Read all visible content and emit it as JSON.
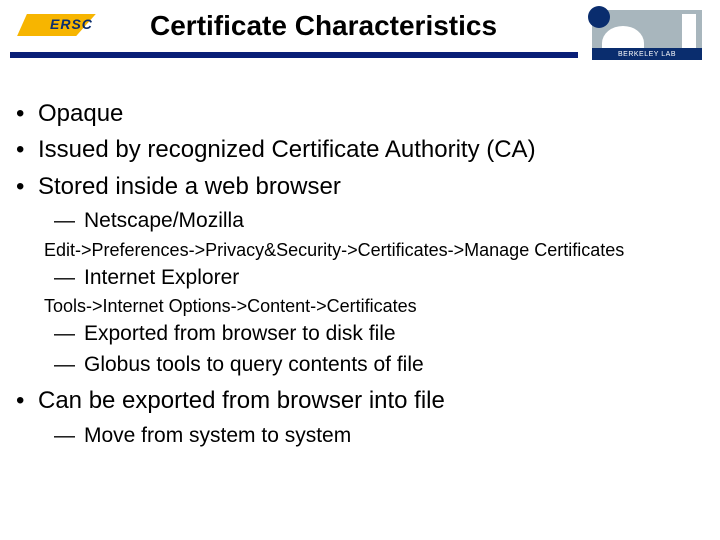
{
  "header": {
    "logo_left_text": "ERSC",
    "title": "Certificate Characteristics",
    "logo_right_caption": "BERKELEY LAB"
  },
  "bullets": {
    "b1": "Opaque",
    "b2": "Issued by recognized Certificate Authority (CA)",
    "b3": "Stored inside a web browser",
    "b3a": "Netscape/Mozilla",
    "b3a_note": "Edit->Preferences->Privacy&Security->Certificates->Manage Certificates",
    "b3b": "Internet Explorer",
    "b3b_note": "Tools->Internet Options->Content->Certificates",
    "b3c": "Exported from browser to disk file",
    "b3d": "Globus tools to query contents of file",
    "b4": "Can be exported from browser into file",
    "b4a": "Move from system to system"
  }
}
